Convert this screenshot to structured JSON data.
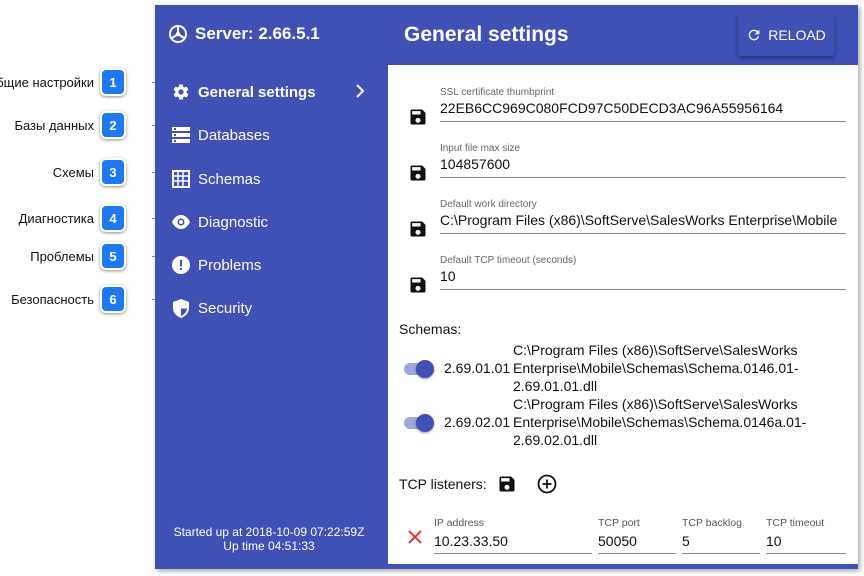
{
  "callouts": [
    {
      "text": "Общие настройки",
      "num": "1"
    },
    {
      "text": "Базы данных",
      "num": "2"
    },
    {
      "text": "Схемы",
      "num": "3"
    },
    {
      "text": "Диагностика",
      "num": "4"
    },
    {
      "text": "Проблемы",
      "num": "5"
    },
    {
      "text": "Безопасность",
      "num": "6"
    }
  ],
  "sidebar": {
    "server_title": "Server: 2.66.5.1",
    "items": [
      {
        "label": "General settings",
        "icon": "gear-icon"
      },
      {
        "label": "Databases",
        "icon": "database-icon"
      },
      {
        "label": "Schemas",
        "icon": "schema-icon"
      },
      {
        "label": "Diagnostic",
        "icon": "eye-icon"
      },
      {
        "label": "Problems",
        "icon": "alert-icon"
      },
      {
        "label": "Security",
        "icon": "shield-icon"
      }
    ],
    "status_line1": "Started up at 2018-10-09 07:22:59Z",
    "status_line2": "Up time 04:51:33"
  },
  "header": {
    "title": "General settings",
    "reload_label": "RELOAD"
  },
  "settings": [
    {
      "label": "SSL certificate thumbprint",
      "value": "22EB6CC969C080FCD97C50DECD3AC96A55956164"
    },
    {
      "label": "Input file max size",
      "value": "104857600"
    },
    {
      "label": "Default work directory",
      "value": "C:\\Program Files (x86)\\SoftServe\\SalesWorks Enterprise\\Mobile"
    },
    {
      "label": "Default TCP timeout (seconds)",
      "value": "10"
    }
  ],
  "schemas": {
    "label": "Schemas:",
    "items": [
      {
        "version": "2.69.01.01",
        "path": "C:\\Program Files (x86)\\SoftServe\\SalesWorks\nEnterprise\\Mobile\\Schemas\\Schema.0146.01-\n2.69.01.01.dll",
        "enabled": true
      },
      {
        "version": "2.69.02.01",
        "path": "C:\\Program Files (x86)\\SoftServe\\SalesWorks\nEnterprise\\Mobile\\Schemas\\Schema.0146a.01-\n2.69.02.01.dll",
        "enabled": true
      }
    ]
  },
  "tcp": {
    "label": "TCP listeners:",
    "columns": {
      "ip": "IP address",
      "port": "TCP port",
      "backlog": "TCP backlog",
      "timeout": "TCP timeout"
    },
    "rows": [
      {
        "ip": "10.23.33.50",
        "port": "50050",
        "backlog": "5",
        "timeout": "10"
      }
    ]
  },
  "colors": {
    "primary": "#3f51b5",
    "callout": "#1e78f0",
    "delete": "#e53935"
  }
}
